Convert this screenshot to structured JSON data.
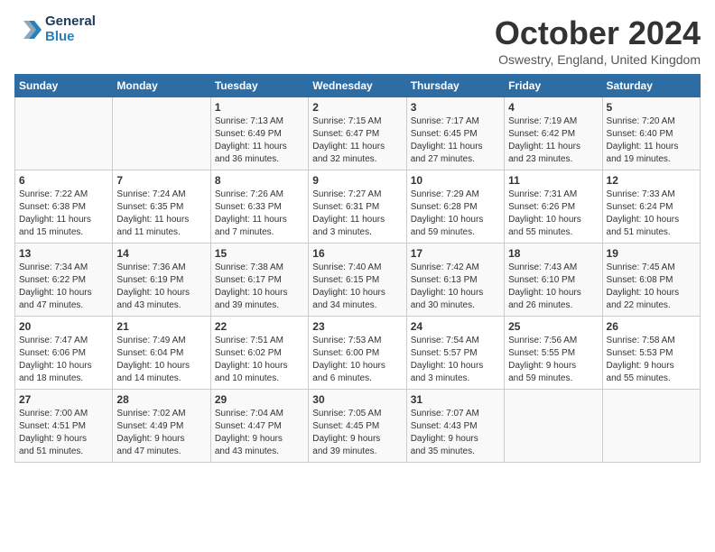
{
  "header": {
    "logo_line1": "General",
    "logo_line2": "Blue",
    "month": "October 2024",
    "location": "Oswestry, England, United Kingdom"
  },
  "days_of_week": [
    "Sunday",
    "Monday",
    "Tuesday",
    "Wednesday",
    "Thursday",
    "Friday",
    "Saturday"
  ],
  "weeks": [
    [
      {
        "day": "",
        "data": ""
      },
      {
        "day": "",
        "data": ""
      },
      {
        "day": "1",
        "data": "Sunrise: 7:13 AM\nSunset: 6:49 PM\nDaylight: 11 hours\nand 36 minutes."
      },
      {
        "day": "2",
        "data": "Sunrise: 7:15 AM\nSunset: 6:47 PM\nDaylight: 11 hours\nand 32 minutes."
      },
      {
        "day": "3",
        "data": "Sunrise: 7:17 AM\nSunset: 6:45 PM\nDaylight: 11 hours\nand 27 minutes."
      },
      {
        "day": "4",
        "data": "Sunrise: 7:19 AM\nSunset: 6:42 PM\nDaylight: 11 hours\nand 23 minutes."
      },
      {
        "day": "5",
        "data": "Sunrise: 7:20 AM\nSunset: 6:40 PM\nDaylight: 11 hours\nand 19 minutes."
      }
    ],
    [
      {
        "day": "6",
        "data": "Sunrise: 7:22 AM\nSunset: 6:38 PM\nDaylight: 11 hours\nand 15 minutes."
      },
      {
        "day": "7",
        "data": "Sunrise: 7:24 AM\nSunset: 6:35 PM\nDaylight: 11 hours\nand 11 minutes."
      },
      {
        "day": "8",
        "data": "Sunrise: 7:26 AM\nSunset: 6:33 PM\nDaylight: 11 hours\nand 7 minutes."
      },
      {
        "day": "9",
        "data": "Sunrise: 7:27 AM\nSunset: 6:31 PM\nDaylight: 11 hours\nand 3 minutes."
      },
      {
        "day": "10",
        "data": "Sunrise: 7:29 AM\nSunset: 6:28 PM\nDaylight: 10 hours\nand 59 minutes."
      },
      {
        "day": "11",
        "data": "Sunrise: 7:31 AM\nSunset: 6:26 PM\nDaylight: 10 hours\nand 55 minutes."
      },
      {
        "day": "12",
        "data": "Sunrise: 7:33 AM\nSunset: 6:24 PM\nDaylight: 10 hours\nand 51 minutes."
      }
    ],
    [
      {
        "day": "13",
        "data": "Sunrise: 7:34 AM\nSunset: 6:22 PM\nDaylight: 10 hours\nand 47 minutes."
      },
      {
        "day": "14",
        "data": "Sunrise: 7:36 AM\nSunset: 6:19 PM\nDaylight: 10 hours\nand 43 minutes."
      },
      {
        "day": "15",
        "data": "Sunrise: 7:38 AM\nSunset: 6:17 PM\nDaylight: 10 hours\nand 39 minutes."
      },
      {
        "day": "16",
        "data": "Sunrise: 7:40 AM\nSunset: 6:15 PM\nDaylight: 10 hours\nand 34 minutes."
      },
      {
        "day": "17",
        "data": "Sunrise: 7:42 AM\nSunset: 6:13 PM\nDaylight: 10 hours\nand 30 minutes."
      },
      {
        "day": "18",
        "data": "Sunrise: 7:43 AM\nSunset: 6:10 PM\nDaylight: 10 hours\nand 26 minutes."
      },
      {
        "day": "19",
        "data": "Sunrise: 7:45 AM\nSunset: 6:08 PM\nDaylight: 10 hours\nand 22 minutes."
      }
    ],
    [
      {
        "day": "20",
        "data": "Sunrise: 7:47 AM\nSunset: 6:06 PM\nDaylight: 10 hours\nand 18 minutes."
      },
      {
        "day": "21",
        "data": "Sunrise: 7:49 AM\nSunset: 6:04 PM\nDaylight: 10 hours\nand 14 minutes."
      },
      {
        "day": "22",
        "data": "Sunrise: 7:51 AM\nSunset: 6:02 PM\nDaylight: 10 hours\nand 10 minutes."
      },
      {
        "day": "23",
        "data": "Sunrise: 7:53 AM\nSunset: 6:00 PM\nDaylight: 10 hours\nand 6 minutes."
      },
      {
        "day": "24",
        "data": "Sunrise: 7:54 AM\nSunset: 5:57 PM\nDaylight: 10 hours\nand 3 minutes."
      },
      {
        "day": "25",
        "data": "Sunrise: 7:56 AM\nSunset: 5:55 PM\nDaylight: 9 hours\nand 59 minutes."
      },
      {
        "day": "26",
        "data": "Sunrise: 7:58 AM\nSunset: 5:53 PM\nDaylight: 9 hours\nand 55 minutes."
      }
    ],
    [
      {
        "day": "27",
        "data": "Sunrise: 7:00 AM\nSunset: 4:51 PM\nDaylight: 9 hours\nand 51 minutes."
      },
      {
        "day": "28",
        "data": "Sunrise: 7:02 AM\nSunset: 4:49 PM\nDaylight: 9 hours\nand 47 minutes."
      },
      {
        "day": "29",
        "data": "Sunrise: 7:04 AM\nSunset: 4:47 PM\nDaylight: 9 hours\nand 43 minutes."
      },
      {
        "day": "30",
        "data": "Sunrise: 7:05 AM\nSunset: 4:45 PM\nDaylight: 9 hours\nand 39 minutes."
      },
      {
        "day": "31",
        "data": "Sunrise: 7:07 AM\nSunset: 4:43 PM\nDaylight: 9 hours\nand 35 minutes."
      },
      {
        "day": "",
        "data": ""
      },
      {
        "day": "",
        "data": ""
      }
    ]
  ]
}
